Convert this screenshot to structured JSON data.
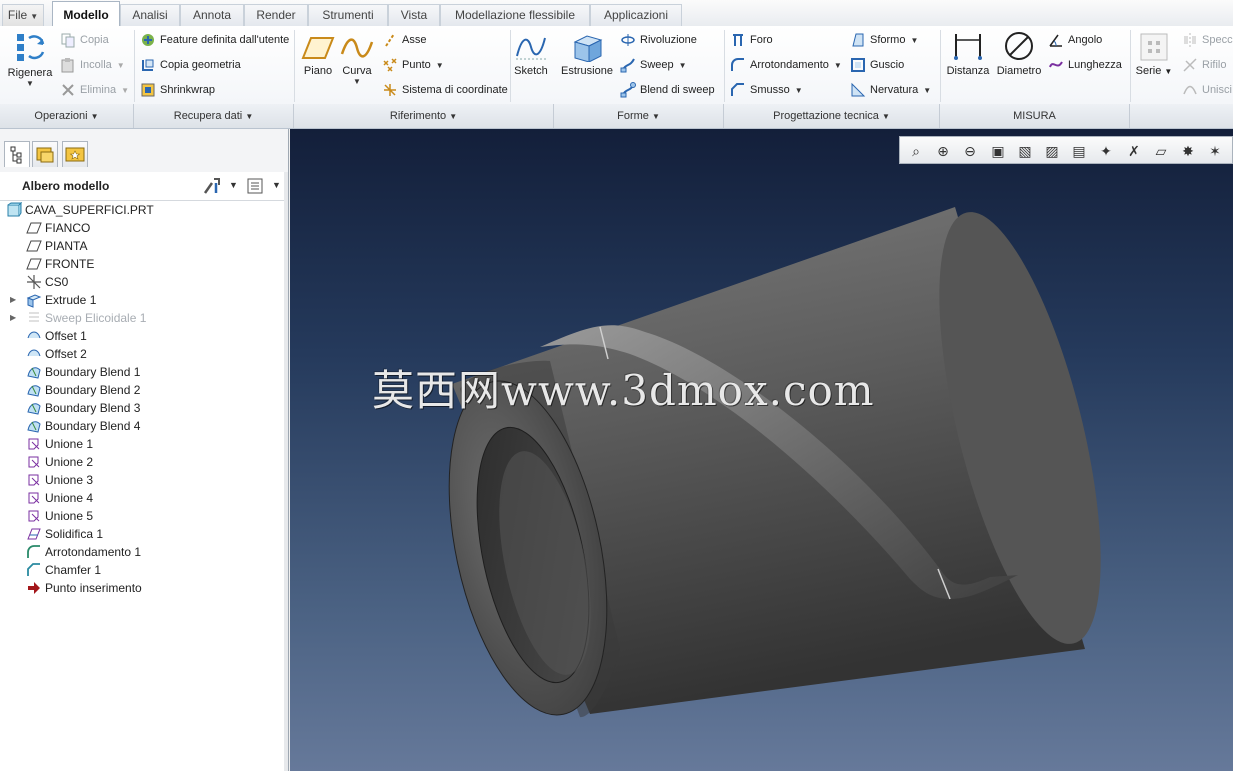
{
  "tabs": [
    {
      "label": "File",
      "dropdown": true
    },
    {
      "label": "Modello",
      "active": true
    },
    {
      "label": "Analisi"
    },
    {
      "label": "Annota"
    },
    {
      "label": "Render"
    },
    {
      "label": "Strumenti"
    },
    {
      "label": "Vista"
    },
    {
      "label": "Modellazione flessibile"
    },
    {
      "label": "Applicazioni"
    }
  ],
  "ribbon": {
    "operazioni": {
      "rigenera": "Rigenera",
      "copia": "Copia",
      "incolla": "Incolla",
      "elimina": "Elimina"
    },
    "recupera": {
      "feature_utente": "Feature definita dall'utente",
      "copia_geometria": "Copia geometria",
      "shrinkwrap": "Shrinkwrap"
    },
    "riferimento": {
      "piano": "Piano",
      "curva": "Curva",
      "asse": "Asse",
      "punto": "Punto",
      "sistema_coordinate": "Sistema di coordinate"
    },
    "forme": {
      "sketch": "Sketch",
      "estrusione": "Estrusione",
      "rivoluzione": "Rivoluzione",
      "sweep": "Sweep",
      "blend_sweep": "Blend di sweep"
    },
    "progettazione": {
      "foro": "Foro",
      "arrotondamento": "Arrotondamento",
      "smusso": "Smusso",
      "sformo": "Sformo",
      "guscio": "Guscio",
      "nervatura": "Nervatura"
    },
    "misura": {
      "distanza": "Distanza",
      "diametro": "Diametro",
      "angolo": "Angolo",
      "lunghezza": "Lunghezza"
    },
    "serie": {
      "serie": "Serie",
      "specchio": "Specch",
      "rifilo": "Rifilo",
      "unisci": "Unisci"
    }
  },
  "groups": [
    {
      "label": "Operazioni",
      "dropdown": true
    },
    {
      "label": "Recupera dati",
      "dropdown": true
    },
    {
      "label": "Riferimento",
      "dropdown": true
    },
    {
      "label": "Forme",
      "dropdown": true
    },
    {
      "label": "Progettazione tecnica",
      "dropdown": true
    },
    {
      "label": "MISURA",
      "dropdown": false
    }
  ],
  "model_tree": {
    "title": "Albero modello",
    "items": [
      {
        "label": "CAVA_SUPERFICI.PRT",
        "icon": "part-icon",
        "expandable": false,
        "dim": false,
        "root": true
      },
      {
        "label": "FIANCO",
        "icon": "datum-plane-icon",
        "expandable": false,
        "dim": false
      },
      {
        "label": "PIANTA",
        "icon": "datum-plane-icon",
        "expandable": false,
        "dim": false
      },
      {
        "label": "FRONTE",
        "icon": "datum-plane-icon",
        "expandable": false,
        "dim": false
      },
      {
        "label": "CS0",
        "icon": "coordinate-system-icon",
        "expandable": false,
        "dim": false
      },
      {
        "label": "Extrude 1",
        "icon": "extrude-icon",
        "expandable": true,
        "dim": false
      },
      {
        "label": "Sweep Elicoidale 1",
        "icon": "helical-sweep-icon",
        "expandable": true,
        "dim": true
      },
      {
        "label": "Offset 1",
        "icon": "offset-icon",
        "expandable": false,
        "dim": false
      },
      {
        "label": "Offset 2",
        "icon": "offset-icon",
        "expandable": false,
        "dim": false
      },
      {
        "label": "Boundary Blend 1",
        "icon": "boundary-blend-icon",
        "expandable": false,
        "dim": false
      },
      {
        "label": "Boundary Blend 2",
        "icon": "boundary-blend-icon",
        "expandable": false,
        "dim": false
      },
      {
        "label": "Boundary Blend 3",
        "icon": "boundary-blend-icon",
        "expandable": false,
        "dim": false
      },
      {
        "label": "Boundary Blend 4",
        "icon": "boundary-blend-icon",
        "expandable": false,
        "dim": false
      },
      {
        "label": "Unione 1",
        "icon": "merge-icon",
        "expandable": false,
        "dim": false
      },
      {
        "label": "Unione 2",
        "icon": "merge-icon",
        "expandable": false,
        "dim": false
      },
      {
        "label": "Unione 3",
        "icon": "merge-icon",
        "expandable": false,
        "dim": false
      },
      {
        "label": "Unione 4",
        "icon": "merge-icon",
        "expandable": false,
        "dim": false
      },
      {
        "label": "Unione 5",
        "icon": "merge-icon",
        "expandable": false,
        "dim": false
      },
      {
        "label": "Solidifica 1",
        "icon": "solidify-icon",
        "expandable": false,
        "dim": false
      },
      {
        "label": "Arrotondamento 1",
        "icon": "round-icon",
        "expandable": false,
        "dim": false
      },
      {
        "label": "Chamfer 1",
        "icon": "chamfer-icon",
        "expandable": false,
        "dim": false
      },
      {
        "label": "Punto inserimento",
        "icon": "insert-here-icon",
        "expandable": false,
        "dim": false
      }
    ]
  },
  "viewport": {
    "watermark": "莫西网www.3dmox.com"
  },
  "colors": {
    "accent_blue": "#1f6fb5",
    "viewport_top": "#131f3a",
    "viewport_bottom": "#66799a",
    "model_gray": "#5b5b5b"
  }
}
